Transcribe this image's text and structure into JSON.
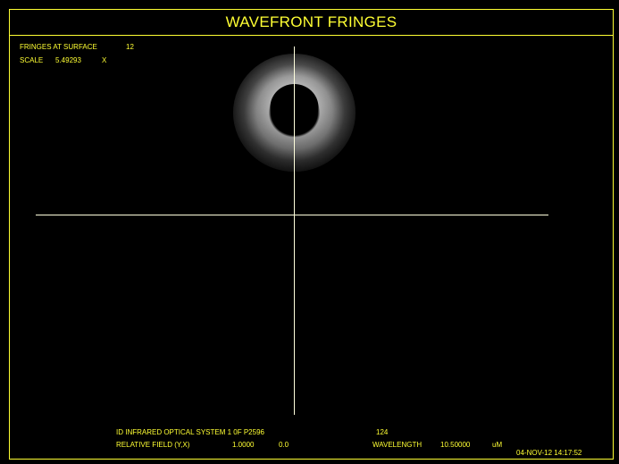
{
  "title": "WAVEFRONT FRINGES",
  "header": {
    "fringes_label": "FRINGES AT SURFACE",
    "fringes_value": "12",
    "scale_label": "SCALE",
    "scale_value": "5.49293",
    "scale_unit": "X"
  },
  "footer": {
    "system_id": "ID INFRARED OPTICAL SYSTEM 1 0F P2596",
    "system_number": "124",
    "field_label": "RELATIVE FIELD (Y,X)",
    "field_y": "1.0000",
    "field_x": "0.0",
    "wavelength_label": "WAVELENGTH",
    "wavelength_value": "10.50000",
    "wavelength_unit": "uM",
    "timestamp": "04-NOV-12  14:17:52"
  },
  "colors": {
    "background": "#000000",
    "text": "#ffff33",
    "crosshair": "#ffffdd"
  }
}
